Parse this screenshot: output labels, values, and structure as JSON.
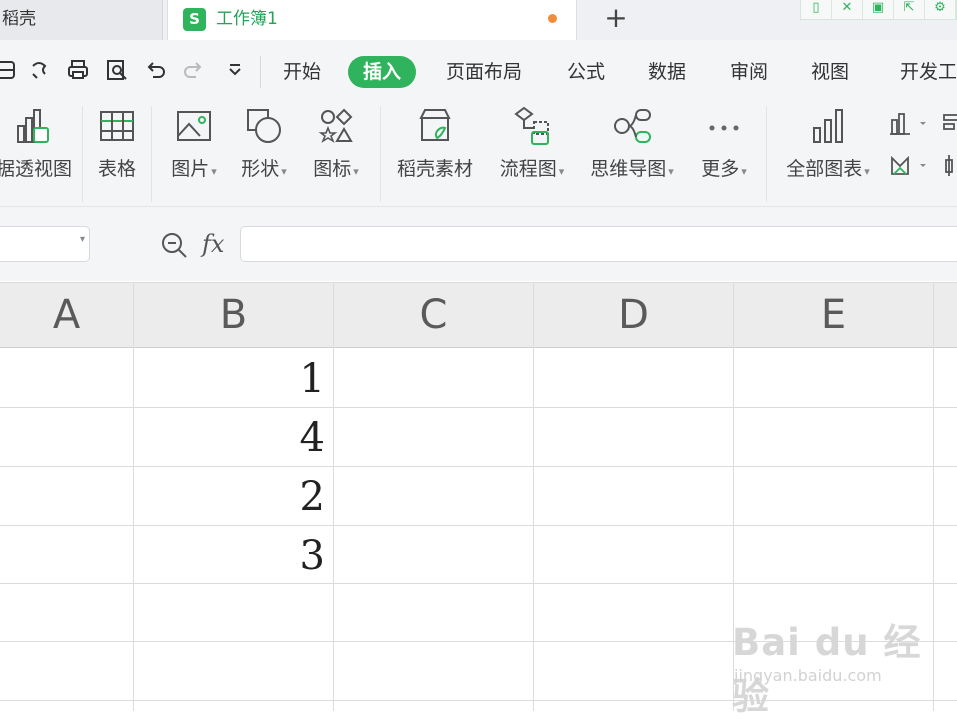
{
  "tabs": {
    "home_label": "稻壳",
    "workbook_icon": "S",
    "workbook_title": "工作簿1",
    "new_tab_label": "+"
  },
  "quick_access": [
    "save-icon",
    "redo-alt-icon",
    "print-icon",
    "print-preview-icon",
    "undo-icon",
    "redo-icon",
    "customize-dropdown-icon"
  ],
  "menu": {
    "items": [
      "开始",
      "插入",
      "页面布局",
      "公式",
      "数据",
      "审阅",
      "视图",
      "开发工"
    ],
    "active": "插入"
  },
  "ribbon": {
    "pivot": "据透视图",
    "table": "表格",
    "picture": "图片",
    "shape": "形状",
    "icon": "图标",
    "docer_material": "稻壳素材",
    "flowchart": "流程图",
    "mindmap": "思维导图",
    "more": "更多",
    "all_charts": "全部图表"
  },
  "formula_bar": {
    "fx_label": "fx",
    "name_box_value": "",
    "formula_value": ""
  },
  "sheet": {
    "columns": [
      "A",
      "B",
      "C",
      "D",
      "E"
    ],
    "column_b_values": [
      "1",
      "4",
      "2",
      "3"
    ]
  },
  "watermark": {
    "brand": "Bai du 经验",
    "url": "jingyan.baidu.com"
  },
  "colors": {
    "accent": "#2fb35c",
    "modified_dot": "#f08c3a"
  }
}
